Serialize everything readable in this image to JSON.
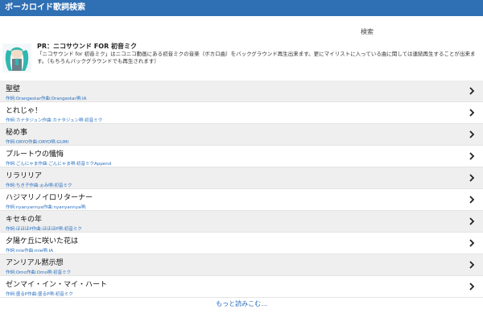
{
  "header": {
    "title": "ボーカロイド歌詞検索"
  },
  "search": {
    "label": "検索"
  },
  "pr": {
    "title": "PR：ニコサウンド FOR 初音ミク",
    "description": "「ニコサウンド for 初音ミク」はニコニコ動画にある初音ミクの音楽（ボカロ曲）をバックグラウンド再生出来ます。更にマイリストに入っている曲に関しては連続再生することが出来ます。（もちろんバックグラウンドでも再生されます）",
    "avatar_icon": "miku-avatar-icon"
  },
  "songs": [
    {
      "title": "聖壁",
      "credit": "作詞:Orangestar作曲:Orangestar唄:IA"
    },
    {
      "title": "とれじゃ！",
      "credit": "作詞:カナタジュン作曲:カナタジュン唄:初音ミク"
    },
    {
      "title": "秘め事",
      "credit": "作詞:ORYO作曲:ORYO唄:GUMI"
    },
    {
      "title": "プルートウの懺悔",
      "credit": "作詞:ごんにゃま作曲:ごんにゃま唄:初音ミクAppend"
    },
    {
      "title": "リラリリア",
      "credit": "作詞:ちき子作曲:ぉみ唄:初音ミク"
    },
    {
      "title": "ハジマリノイロリターナー",
      "credit": "作詞:nyanyannya作曲:nyanyannya唄:"
    },
    {
      "title": "キセキの年",
      "credit": "作詞:ほほほP作曲:ほほほP唄:初音ミク"
    },
    {
      "title": "夕陽ケ丘に咲いた花は",
      "credit": "作詞:mie作曲:mie唄:IA"
    },
    {
      "title": "アンリアル黙示想",
      "credit": "作詞:Omo作曲:Omo唄:初音ミク"
    },
    {
      "title": "ゼンマイ・イン・マイ・ハート",
      "credit": "作詞:盛るP作曲:盛るP唄:初音ミク"
    }
  ],
  "more": {
    "label": "もっと読みこむ..."
  },
  "colors": {
    "header_bg": "#2f6fb4",
    "link": "#2a6fbe",
    "row_alt": "#efefef"
  }
}
